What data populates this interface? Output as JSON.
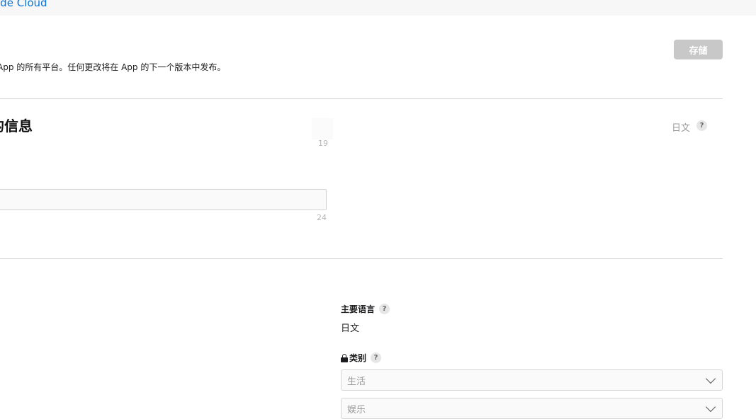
{
  "topbar": {
    "link_text": "ode Cloud"
  },
  "header": {
    "mark": ".",
    "description": "App 的所有平台。任何更改将在 App 的下一个版本中发布。",
    "save_label": "存储"
  },
  "localizable_section": {
    "title": "的信息",
    "language": "日文",
    "help_glyph": "?",
    "name_counter": "19",
    "subtitle_value": "",
    "subtitle_counter": "24"
  },
  "general_section": {
    "primary_language_label": "主要语言",
    "primary_language_value": "日文",
    "help_glyph": "?",
    "category_label": "类别",
    "primary_category": "生活",
    "secondary_category": "娱乐"
  },
  "colors": {
    "link": "#0a73d9",
    "save_disabled_bg": "#c8c8c8",
    "divider": "#d6d6d6"
  }
}
